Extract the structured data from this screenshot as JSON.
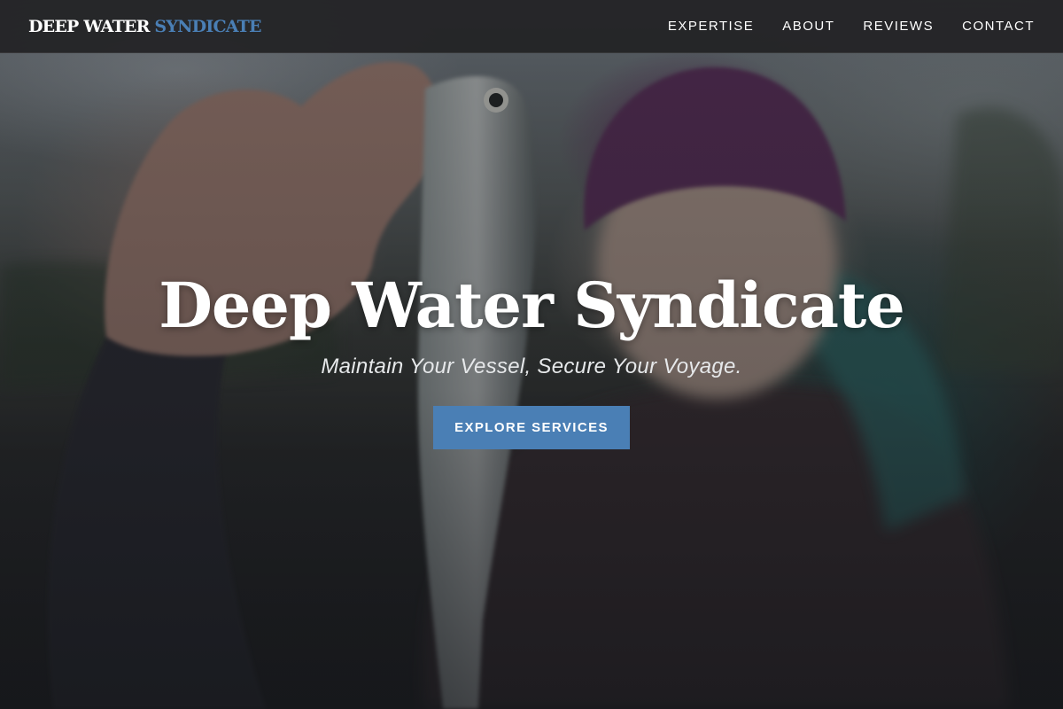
{
  "header": {
    "logo": {
      "primary": "DEEP WATER",
      "accent": "SYNDICATE"
    },
    "nav": [
      {
        "label": "EXPERTISE"
      },
      {
        "label": "ABOUT"
      },
      {
        "label": "REVIEWS"
      },
      {
        "label": "CONTACT"
      }
    ]
  },
  "hero": {
    "title": "Deep Water Syndicate",
    "subtitle": "Maintain Your Vessel, Secure Your Voyage.",
    "cta_label": "EXPLORE SERVICES"
  },
  "colors": {
    "accent": "#4a7fb5",
    "navbar": "#222224",
    "text": "#ffffff"
  }
}
